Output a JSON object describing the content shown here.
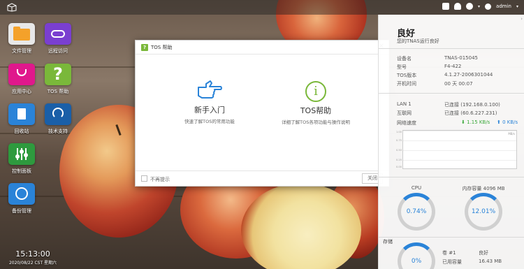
{
  "topbar": {
    "user": "admin"
  },
  "desktop_icons": [
    {
      "label": "文件管理",
      "icon": "folder-icon"
    },
    {
      "label": "远程访问",
      "icon": "cloud-icon"
    },
    {
      "label": "应用中心",
      "icon": "shopping-bag-icon"
    },
    {
      "label": "TOS 帮助",
      "icon": "question-icon"
    },
    {
      "label": "回收站",
      "icon": "recycle-bin-icon"
    },
    {
      "label": "技术支持",
      "icon": "headset-icon"
    },
    {
      "label": "控制面板",
      "icon": "sliders-icon"
    },
    {
      "label": "备份管理",
      "icon": "backup-clock-icon"
    }
  ],
  "clock": {
    "time": "15:13:00",
    "date": "2020/08/22 CST 星期六"
  },
  "dialog": {
    "title": "TOS 帮助",
    "option1_title": "新手入门",
    "option1_desc": "快速了解TOS的常用功能",
    "option2_title": "TOS帮助",
    "option2_desc": "详细了解TOS各项功能与操作说明",
    "checkbox_label": "不再提示",
    "close_label": "关闭",
    "accent": "#7ab83a"
  },
  "panel": {
    "status_title": "良好",
    "status_sub": "您的TNAS运行良好",
    "device_name_label": "设备名",
    "device_name": "TNAS-015045",
    "model_label": "型号",
    "model": "F4-422",
    "tos_version_label": "TOS版本",
    "tos_version": "4.1.27-2006301044",
    "uptime_label": "开机时间",
    "uptime": "00 天 00:07",
    "lan_label": "LAN 1",
    "lan_value": "已连接 (192.168.0.100)",
    "internet_label": "互联网",
    "internet_value": "已连接 (60.6.227.231)",
    "speed_label": "网络速度",
    "speed_down": "1.15 KB/s",
    "speed_up": "0 KB/s",
    "graph_unit": "MB/s",
    "graph_ticks": [
      "1.00",
      "0.75",
      "0.50",
      "0.25",
      "0.00"
    ],
    "cpu_label": "CPU",
    "cpu_value": "0.74%",
    "cpu_fraction": 0.0074,
    "memory_label": "内存容量 4096 MB",
    "memory_value": "12.01%",
    "memory_fraction": 0.1201,
    "storage_label": "存储",
    "storage_value": "0%",
    "volume_label": "卷 #1",
    "volume_status": "良好",
    "used_label": "已用容量",
    "used_value": "16.43 MB"
  }
}
